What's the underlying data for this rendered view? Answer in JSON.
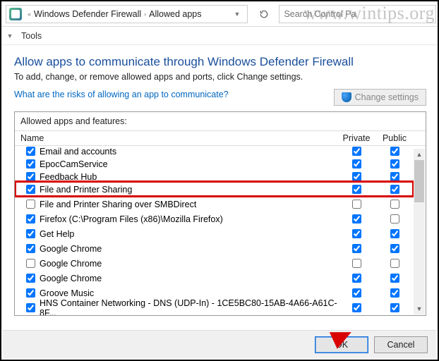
{
  "watermark": "www.wintips.org",
  "breadcrumb": {
    "a": "Windows Defender Firewall",
    "b": "Allowed apps"
  },
  "search": {
    "placeholder": "Search Control Pa"
  },
  "menu": {
    "tools": "Tools"
  },
  "heading": "Allow apps to communicate through Windows Defender Firewall",
  "subtitle": "To add, change, or remove allowed apps and ports, click Change settings.",
  "risk_link": "What are the risks of allowing an app to communicate?",
  "change_settings": "Change settings",
  "list_label": "Allowed apps and features:",
  "columns": {
    "name": "Name",
    "private": "Private",
    "public": "Public"
  },
  "rows": [
    {
      "name": "Email and accounts",
      "on": true,
      "priv": true,
      "pub": true,
      "cut": true
    },
    {
      "name": "EpocCamService",
      "on": true,
      "priv": true,
      "pub": true
    },
    {
      "name": "Feedback Hub",
      "on": true,
      "priv": true,
      "pub": true,
      "cut": true
    },
    {
      "name": "File and Printer Sharing",
      "on": true,
      "priv": true,
      "pub": true,
      "hl": true
    },
    {
      "name": "File and Printer Sharing over SMBDirect",
      "on": false,
      "priv": false,
      "pub": false
    },
    {
      "name": "Firefox (C:\\Program Files (x86)\\Mozilla Firefox)",
      "on": true,
      "priv": true,
      "pub": false
    },
    {
      "name": "Get Help",
      "on": true,
      "priv": true,
      "pub": true
    },
    {
      "name": "Google Chrome",
      "on": true,
      "priv": true,
      "pub": true
    },
    {
      "name": "Google Chrome",
      "on": false,
      "priv": false,
      "pub": false
    },
    {
      "name": "Google Chrome",
      "on": true,
      "priv": true,
      "pub": true
    },
    {
      "name": "Groove Music",
      "on": true,
      "priv": true,
      "pub": true
    },
    {
      "name": "HNS Container Networking - DNS (UDP-In) - 1CE5BC80-15AB-4A66-A61C-8F...",
      "on": true,
      "priv": true,
      "pub": true
    }
  ],
  "footer": {
    "ok": "OK",
    "cancel": "Cancel"
  }
}
